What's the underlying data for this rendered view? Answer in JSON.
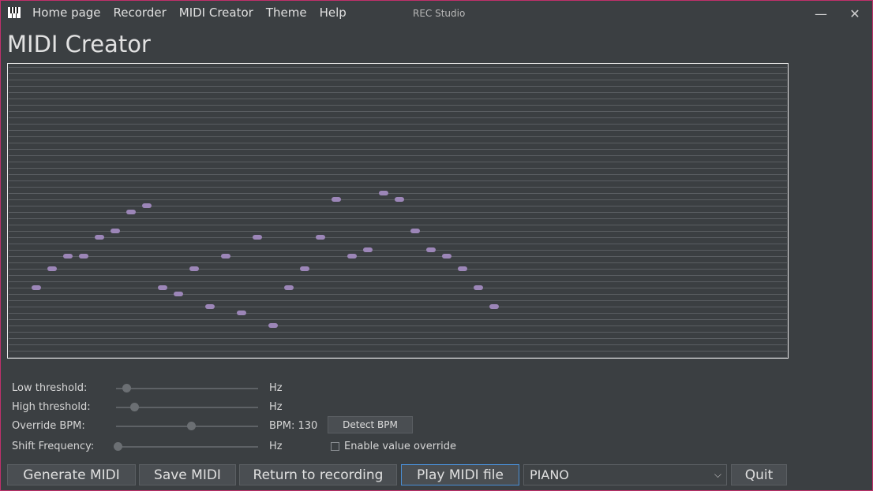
{
  "window": {
    "title": "REC Studio",
    "minimize_glyph": "—",
    "close_glyph": "✕"
  },
  "menu": [
    {
      "label": "Home page"
    },
    {
      "label": "Recorder"
    },
    {
      "label": "MIDI Creator"
    },
    {
      "label": "Theme"
    },
    {
      "label": "Help"
    }
  ],
  "page": {
    "title": "MIDI Creator"
  },
  "roll": {
    "rows": 47,
    "note_color": "#9c86b8",
    "line_color": "#5a5e62",
    "notes": [
      {
        "step": 0,
        "row": 35
      },
      {
        "step": 1,
        "row": 32
      },
      {
        "step": 2,
        "row": 30
      },
      {
        "step": 3,
        "row": 30
      },
      {
        "step": 4,
        "row": 27
      },
      {
        "step": 5,
        "row": 26
      },
      {
        "step": 6,
        "row": 23
      },
      {
        "step": 7,
        "row": 22
      },
      {
        "step": 8,
        "row": 35
      },
      {
        "step": 9,
        "row": 36
      },
      {
        "step": 10,
        "row": 32
      },
      {
        "step": 11,
        "row": 38
      },
      {
        "step": 12,
        "row": 30
      },
      {
        "step": 13,
        "row": 39
      },
      {
        "step": 14,
        "row": 27
      },
      {
        "step": 15,
        "row": 41
      },
      {
        "step": 16,
        "row": 35
      },
      {
        "step": 17,
        "row": 32
      },
      {
        "step": 18,
        "row": 27
      },
      {
        "step": 19,
        "row": 21
      },
      {
        "step": 20,
        "row": 30
      },
      {
        "step": 21,
        "row": 29
      },
      {
        "step": 22,
        "row": 20
      },
      {
        "step": 23,
        "row": 21
      },
      {
        "step": 24,
        "row": 26
      },
      {
        "step": 25,
        "row": 29
      },
      {
        "step": 26,
        "row": 30
      },
      {
        "step": 27,
        "row": 32
      },
      {
        "step": 28,
        "row": 35
      },
      {
        "step": 29,
        "row": 38
      }
    ]
  },
  "controls": {
    "low_threshold": {
      "label": "Low threshold:",
      "unit": "Hz",
      "value": 0.07
    },
    "high_threshold": {
      "label": "High threshold:",
      "unit": "Hz",
      "value": 0.13
    },
    "override_bpm": {
      "label": "Override BPM:",
      "unit": "BPM: 130",
      "value": 0.53,
      "button": "Detect BPM"
    },
    "shift_frequency": {
      "label": "Shift Frequency:",
      "unit": "Hz",
      "value": 0.01,
      "checkbox_label": "Enable value override",
      "checked": false
    }
  },
  "bottom": {
    "generate": "Generate MIDI",
    "save": "Save MIDI",
    "return": "Return to recording",
    "play": "Play MIDI file",
    "instrument": "PIANO",
    "quit": "Quit"
  },
  "icons": {
    "app": "piano-keys-icon",
    "dropdown": "chevron-down-icon"
  }
}
